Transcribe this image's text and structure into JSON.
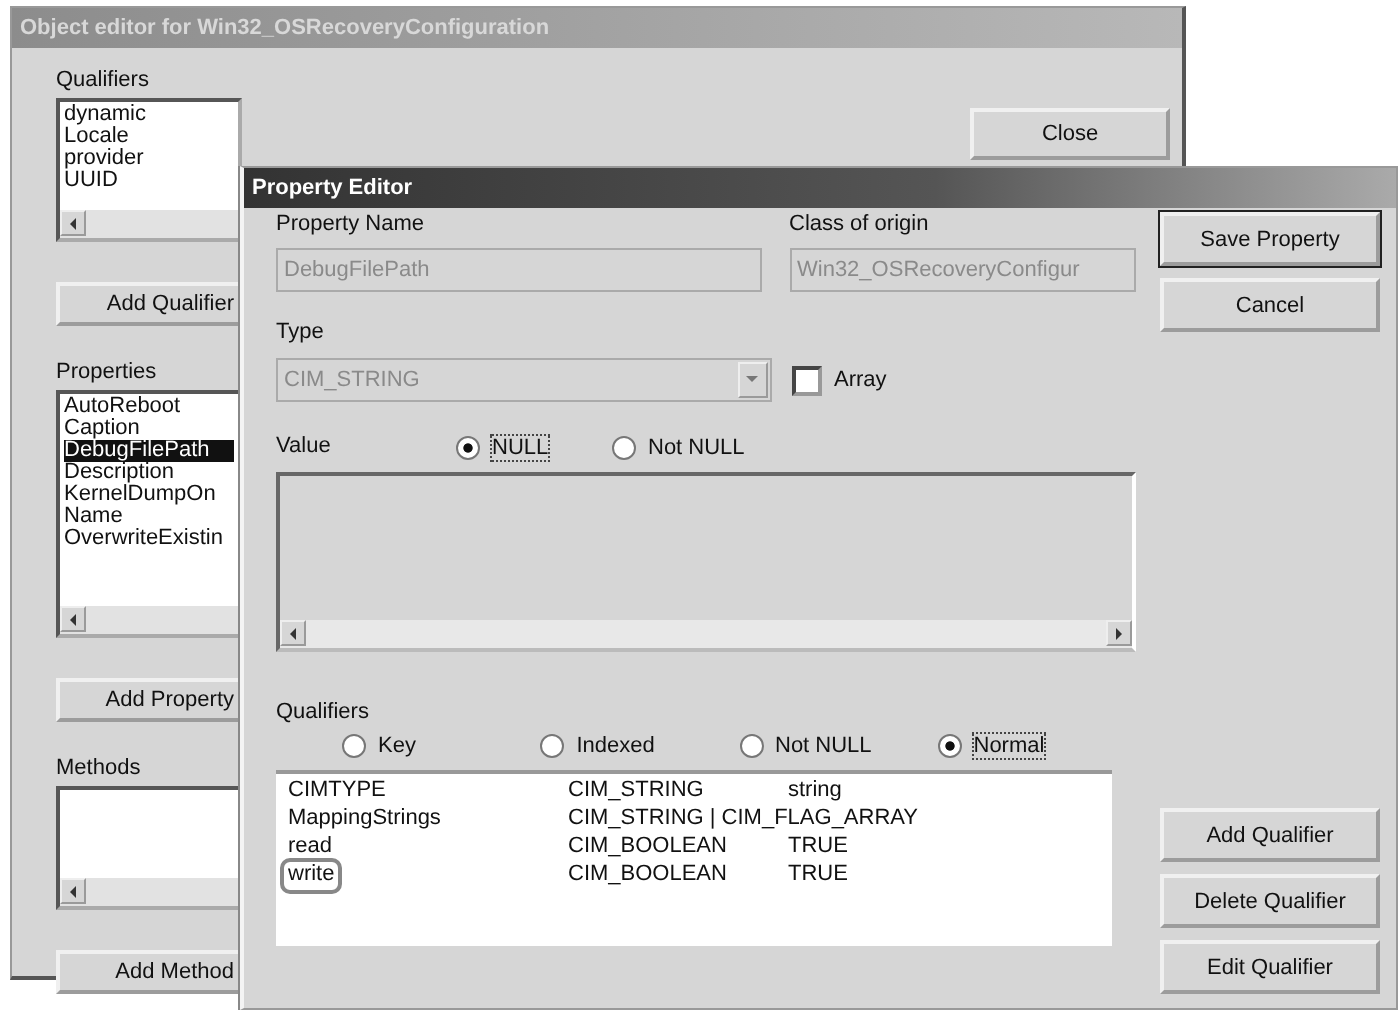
{
  "back_window": {
    "title": "Object editor for Win32_OSRecoveryConfiguration",
    "close_button": "Close",
    "qualifiers": {
      "label": "Qualifiers",
      "items": [
        {
          "text": "dynamic"
        },
        {
          "text": "Locale"
        },
        {
          "text": "provider"
        },
        {
          "text": "UUID"
        }
      ],
      "button": "Add Qualifier"
    },
    "properties": {
      "label": "Properties",
      "items": [
        {
          "text": "AutoReboot",
          "selected": false
        },
        {
          "text": "Caption",
          "selected": false
        },
        {
          "text": "DebugFilePath",
          "selected": true
        },
        {
          "text": "Description",
          "selected": false
        },
        {
          "text": "KernelDumpOn",
          "selected": false
        },
        {
          "text": "Name",
          "selected": false
        },
        {
          "text": "OverwriteExistin",
          "selected": false
        }
      ],
      "button": "Add Property"
    },
    "methods": {
      "label": "Methods",
      "button": "Add Method"
    }
  },
  "property_editor": {
    "title": "Property Editor",
    "property_name": {
      "label": "Property Name",
      "value": "DebugFilePath",
      "disabled": true
    },
    "class_of_origin": {
      "label": "Class of origin",
      "value": "Win32_OSRecoveryConfigur",
      "disabled": true
    },
    "type": {
      "label": "Type",
      "value": "CIM_STRING",
      "disabled": true
    },
    "array": {
      "label": "Array",
      "checked": false
    },
    "value": {
      "label": "Value",
      "options": [
        {
          "label": "NULL",
          "selected": true
        },
        {
          "label": "Not NULL",
          "selected": false
        }
      ]
    },
    "qualifiers": {
      "label": "Qualifiers",
      "options": [
        {
          "label": "Key",
          "selected": false
        },
        {
          "label": "Indexed",
          "selected": false
        },
        {
          "label": "Not NULL",
          "selected": false
        },
        {
          "label": "Normal",
          "selected": true
        }
      ],
      "rows": [
        {
          "name": "CIMTYPE",
          "type": "CIM_STRING",
          "value": "string",
          "marked": false
        },
        {
          "name": "MappingStrings",
          "type": "CIM_STRING | CIM_FLAG_ARRAY",
          "value": "",
          "marked": false
        },
        {
          "name": "read",
          "type": "CIM_BOOLEAN",
          "value": "TRUE",
          "marked": false
        },
        {
          "name": "write",
          "type": "CIM_BOOLEAN",
          "value": "TRUE",
          "marked": true
        }
      ]
    },
    "buttons": {
      "save": "Save Property",
      "cancel": "Cancel",
      "add_qualifier": "Add Qualifier",
      "delete_qualifier": "Delete Qualifier",
      "edit_qualifier": "Edit Qualifier"
    }
  }
}
